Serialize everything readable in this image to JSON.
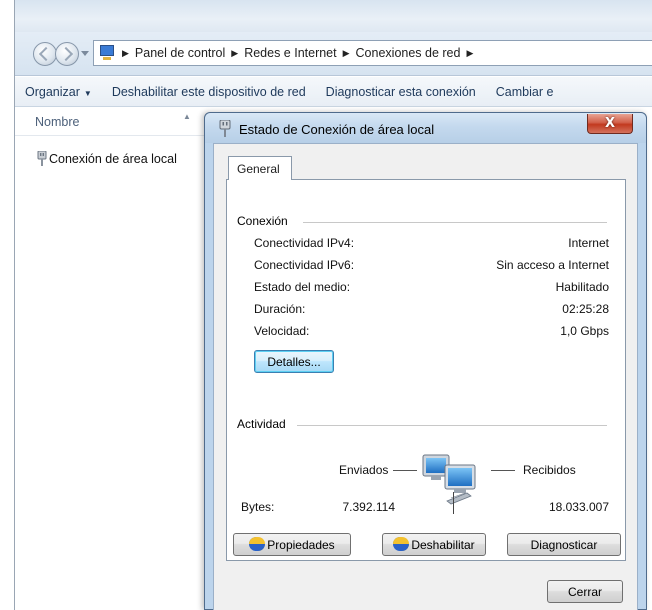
{
  "explorer": {
    "breadcrumb": [
      "Panel de control",
      "Redes e Internet",
      "Conexiones de red"
    ],
    "toolbar": {
      "organize": "Organizar",
      "disable_device": "Deshabilitar este dispositivo de red",
      "diagnose": "Diagnosticar esta conexión",
      "change": "Cambiar e"
    },
    "list_header": "Nombre",
    "items": [
      {
        "label": "Conexión de área local"
      }
    ]
  },
  "dialog": {
    "title": "Estado de Conexión de área local",
    "close_glyph": "X",
    "tab": "General",
    "connection_group": "Conexión",
    "rows": [
      {
        "label": "Conectividad IPv4:",
        "value": "Internet"
      },
      {
        "label": "Conectividad IPv6:",
        "value": "Sin acceso a Internet"
      },
      {
        "label": "Estado del medio:",
        "value": "Habilitado"
      },
      {
        "label": "Duración:",
        "value": "02:25:28"
      },
      {
        "label": "Velocidad:",
        "value": "1,0 Gbps"
      }
    ],
    "details_button": "Detalles...",
    "activity_group": "Actividad",
    "sent_label": "Enviados",
    "received_label": "Recibidos",
    "bytes_label": "Bytes:",
    "bytes_sent": "7.392.114",
    "bytes_received": "18.033.007",
    "properties_button": "Propiedades",
    "disable_button": "Deshabilitar",
    "diagnose_button": "Diagnosticar",
    "close_button": "Cerrar"
  },
  "icons": {
    "control_panel": "control-panel-icon",
    "network_adapter": "network-plug-icon",
    "network_activity": "network-computers-icon",
    "uac_shield": "shield-icon"
  },
  "colors": {
    "accent": "#1e395b",
    "titlebar": "#c4d9ee",
    "close_button": "#c2391f"
  }
}
